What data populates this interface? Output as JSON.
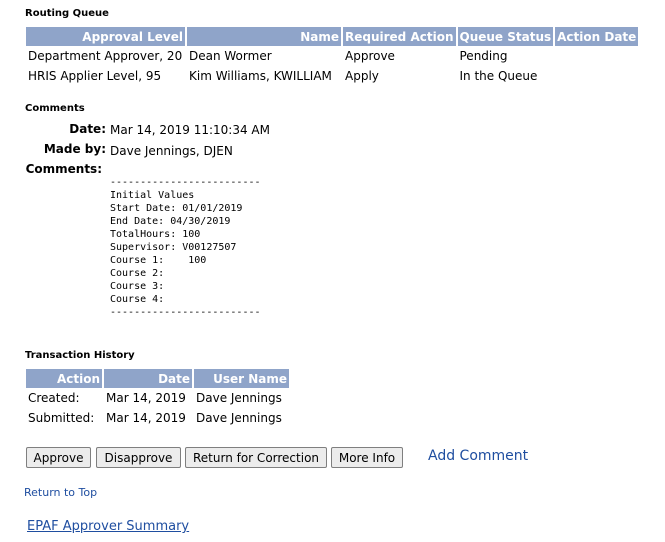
{
  "routing_queue": {
    "title": "Routing Queue",
    "headers": [
      "Approval Level",
      "Name",
      "Required Action",
      "Queue Status",
      "Action Date"
    ],
    "rows": [
      [
        "Department Approver, 20",
        "Dean Wormer",
        "Approve",
        "Pending",
        ""
      ],
      [
        "HRIS Applier Level, 95",
        "Kim Williams, KWILLIAM",
        "Apply",
        "In the Queue",
        ""
      ]
    ]
  },
  "comments": {
    "title": "Comments",
    "date_label": "Date:",
    "date_value": "Mar 14, 2019 11:10:34 AM",
    "made_by_label": "Made by:",
    "made_by_value": "Dave Jennings, DJEN",
    "comments_label": "Comments:",
    "text": "-------------------------\nInitial Values\nStart Date: 01/01/2019\nEnd Date: 04/30/2019\nTotalHours: 100\nSupervisor: V00127507\nCourse 1:    100\nCourse 2:\nCourse 3:\nCourse 4:\n-------------------------"
  },
  "transaction_history": {
    "title": "Transaction History",
    "headers": [
      "Action",
      "Date",
      "User Name"
    ],
    "rows": [
      [
        "Created:",
        "Mar 14, 2019",
        "Dave Jennings"
      ],
      [
        "Submitted:",
        "Mar 14, 2019",
        "Dave Jennings"
      ]
    ]
  },
  "buttons": {
    "approve": "Approve",
    "disapprove": "Disapprove",
    "return_for_correction": "Return for Correction",
    "more_info": "More Info"
  },
  "links": {
    "add_comment": "Add Comment",
    "return_to_top": "Return to Top",
    "epaf_summary": "EPAF Approver Summary"
  }
}
